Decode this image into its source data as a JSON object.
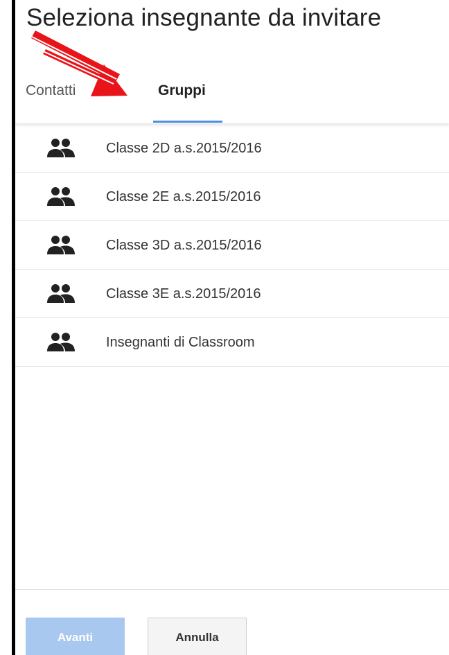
{
  "dialog": {
    "title": "Seleziona insegnante da invitare"
  },
  "tabs": [
    {
      "label": "Contatti",
      "active": false
    },
    {
      "label": "Gruppi",
      "active": true
    }
  ],
  "groups": [
    {
      "label": "Classe 2D a.s.2015/2016",
      "icon": "group-icon"
    },
    {
      "label": "Classe 2E a.s.2015/2016",
      "icon": "group-icon"
    },
    {
      "label": "Classe 3D a.s.2015/2016",
      "icon": "group-icon"
    },
    {
      "label": "Classe 3E a.s.2015/2016",
      "icon": "group-icon"
    },
    {
      "label": "Insegnanti di Classroom",
      "icon": "group-icon"
    }
  ],
  "footer": {
    "next_label": "Avanti",
    "cancel_label": "Annulla"
  },
  "colors": {
    "accent": "#4a8fe0",
    "primary_disabled": "#a9c8ef",
    "annotation_arrow": "#e8141a"
  },
  "annotation": {
    "icon": "red-arrow-icon"
  }
}
